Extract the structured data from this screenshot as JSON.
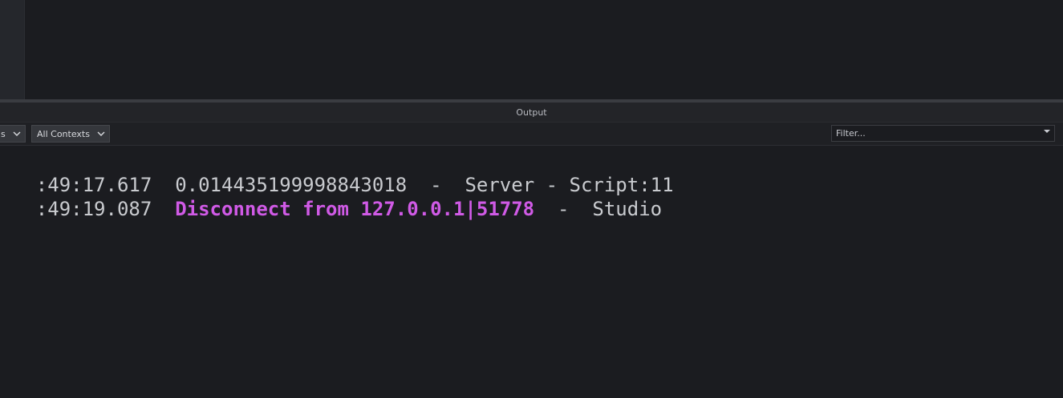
{
  "panel": {
    "title": "Output"
  },
  "toolbar": {
    "levels_label": "s",
    "contexts_label": "All Contexts",
    "filter_placeholder": "Filter..."
  },
  "log": [
    {
      "timestamp": ":49:17.617",
      "message": "0.014435199998843018",
      "separator": "-",
      "source": "Server - Script:11",
      "color": "#c9cbcf"
    },
    {
      "timestamp": ":49:19.087",
      "message": "Disconnect from 127.0.0.1|51778",
      "separator": "-",
      "source": "Studio",
      "color": "#d05ae6"
    }
  ],
  "icons": {
    "dropdown_chevron": "chevron-down-icon",
    "filter_arrow": "caret-down-icon"
  }
}
